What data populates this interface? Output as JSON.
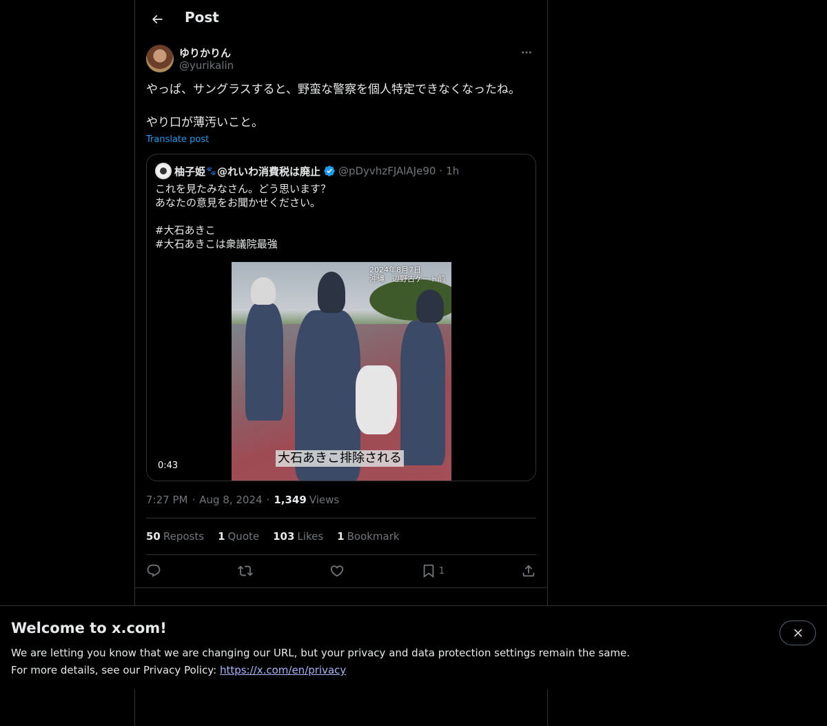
{
  "header": {
    "title": "Post"
  },
  "author": {
    "name": "ゆりかりん",
    "handle": "@yurikalin"
  },
  "post": {
    "text": "やっぱ、サングラスすると、野蛮な警察を個人特定できなくなったね。\n\nやり口が薄汚いこと。",
    "translate_label": "Translate post"
  },
  "quote": {
    "name": "柚子姫",
    "name_suffix": "@れいわ消費税は廃止",
    "handle": "@pDyvhzFJAlAJe90",
    "dot": "·",
    "time": "1h",
    "text": "これを見たみなさん。どう思います？\nあなたの意見をお聞かせください。\n\n#大石あきこ\n#大石あきこは衆議院最強",
    "video": {
      "date_overlay": "2024年8月7日\n沖縄　辺野古ゲート前",
      "caption": "大石あきこ排除される",
      "duration": "0:43"
    }
  },
  "meta": {
    "time": "7:27 PM",
    "sep": "·",
    "date": "Aug 8, 2024",
    "views_count": "1,349",
    "views_label": "Views"
  },
  "stats": {
    "reposts_count": "50",
    "reposts_label": "Reposts",
    "quotes_count": "1",
    "quotes_label": "Quote",
    "likes_count": "103",
    "likes_label": "Likes",
    "bookmarks_count": "1",
    "bookmarks_label": "Bookmark"
  },
  "actions": {
    "bookmark_count": "1"
  },
  "banner": {
    "title": "Welcome to x.com!",
    "line1": "We are letting you know that we are changing our URL, but your privacy and data protection settings remain the same.",
    "line2_prefix": "For more details, see our Privacy Policy: ",
    "link": "https://x.com/en/privacy"
  },
  "colors": {
    "accent": "#1d9bf0",
    "border": "#2f3336",
    "muted": "#71767b",
    "text": "#e7e9ea",
    "link": "#a9b5ff"
  },
  "icons": [
    "back-arrow-icon",
    "more-icon",
    "verified-badge-icon",
    "reply-icon",
    "repost-icon",
    "like-icon",
    "bookmark-icon",
    "share-icon",
    "close-icon"
  ]
}
